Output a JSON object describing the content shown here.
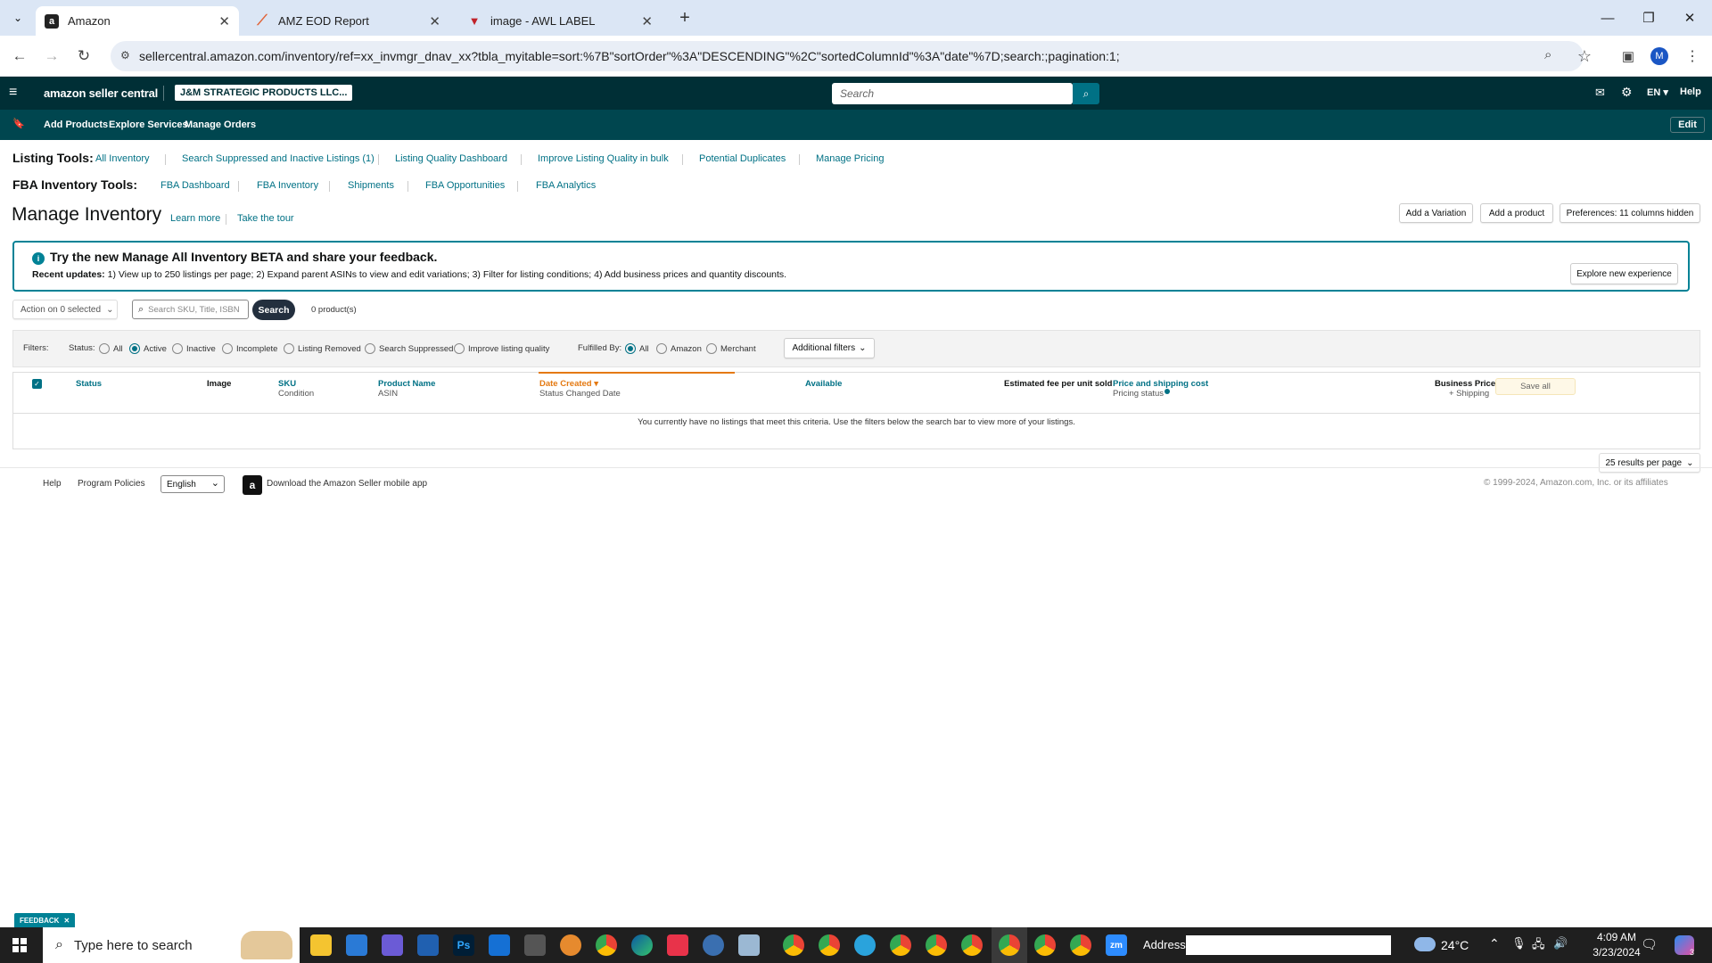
{
  "browser": {
    "tabs": [
      {
        "title": "Amazon",
        "favicon": "a"
      },
      {
        "title": "AMZ EOD Report",
        "favicon": "slash"
      },
      {
        "title": "image - AWL LABEL",
        "favicon": "v"
      }
    ],
    "url": "sellercentral.amazon.com/inventory/ref=xx_invmgr_dnav_xx?tbla_myitable=sort:%7B\"sortOrder\"%3A\"DESCENDING\"%2C\"sortedColumnId\"%3A\"date\"%7D;search:;pagination:1;",
    "profile_initial": "M"
  },
  "header": {
    "logo": "amazon seller central",
    "store": "J&M STRATEGIC PRODUCTS LLC...",
    "search_placeholder": "Search",
    "lang": "EN",
    "help": "Help"
  },
  "subnav": {
    "items": [
      "Add Products",
      "Explore Services",
      "Manage Orders"
    ],
    "edit": "Edit"
  },
  "listing_tools": {
    "label": "Listing Tools:",
    "links": [
      "All Inventory",
      "Search Suppressed and Inactive Listings (1)",
      "Listing Quality Dashboard",
      "Improve Listing Quality in bulk",
      "Potential Duplicates",
      "Manage Pricing"
    ]
  },
  "fba_tools": {
    "label": "FBA Inventory Tools:",
    "links": [
      "FBA Dashboard",
      "FBA Inventory",
      "Shipments",
      "FBA Opportunities",
      "FBA Analytics"
    ]
  },
  "page": {
    "title": "Manage Inventory",
    "learn_more": "Learn more",
    "take_tour": "Take the tour",
    "add_variation": "Add a Variation",
    "add_product": "Add a product",
    "preferences": "Preferences: 11 columns hidden"
  },
  "banner": {
    "title": "Try the new Manage All Inventory BETA and share your feedback.",
    "updates_label": "Recent updates:",
    "updates_text": "1) View up to 250 listings per page; 2) Expand parent ASINs to view and edit variations; 3) Filter for listing conditions; 4) Add business prices and quantity discounts.",
    "button": "Explore new experience"
  },
  "actions": {
    "action_select": "Action on 0 selected",
    "search_placeholder": "Search SKU, Title, ISBN",
    "search_button": "Search",
    "product_count": "0 product(s)"
  },
  "filters": {
    "label": "Filters:",
    "status_label": "Status:",
    "status_options": [
      "All",
      "Active",
      "Inactive",
      "Incomplete",
      "Listing Removed",
      "Search Suppressed",
      "Improve listing quality"
    ],
    "status_selected": "Active",
    "fulfilled_label": "Fulfilled By:",
    "fulfilled_options": [
      "All",
      "Amazon",
      "Merchant"
    ],
    "fulfilled_selected": "All",
    "additional": "Additional filters"
  },
  "table": {
    "columns": {
      "status": "Status",
      "image": "Image",
      "sku": "SKU",
      "sku_sub": "Condition",
      "name": "Product Name",
      "name_sub": "ASIN",
      "date": "Date Created",
      "date_sub": "Status Changed Date",
      "available": "Available",
      "fee": "Estimated fee per unit sold",
      "price": "Price and shipping cost",
      "price_sub": "Pricing status",
      "business": "Business Price",
      "business_sub": "+ Shipping"
    },
    "save_all": "Save all",
    "empty_message": "You currently have no listings that meet this criteria. Use the filters below the search bar to view more of your listings.",
    "per_page": "25 results per page"
  },
  "footer": {
    "help": "Help",
    "policies": "Program Policies",
    "language": "English",
    "app": "Download the Amazon Seller mobile app",
    "copyright": "© 1999-2024, Amazon.com, Inc. or its affiliates",
    "feedback": "FEEDBACK"
  },
  "taskbar": {
    "search_placeholder": "Type here to search",
    "address_label": "Address",
    "temperature": "24°C",
    "time": "4:09 AM",
    "date": "3/23/2024",
    "notifications": "3"
  }
}
